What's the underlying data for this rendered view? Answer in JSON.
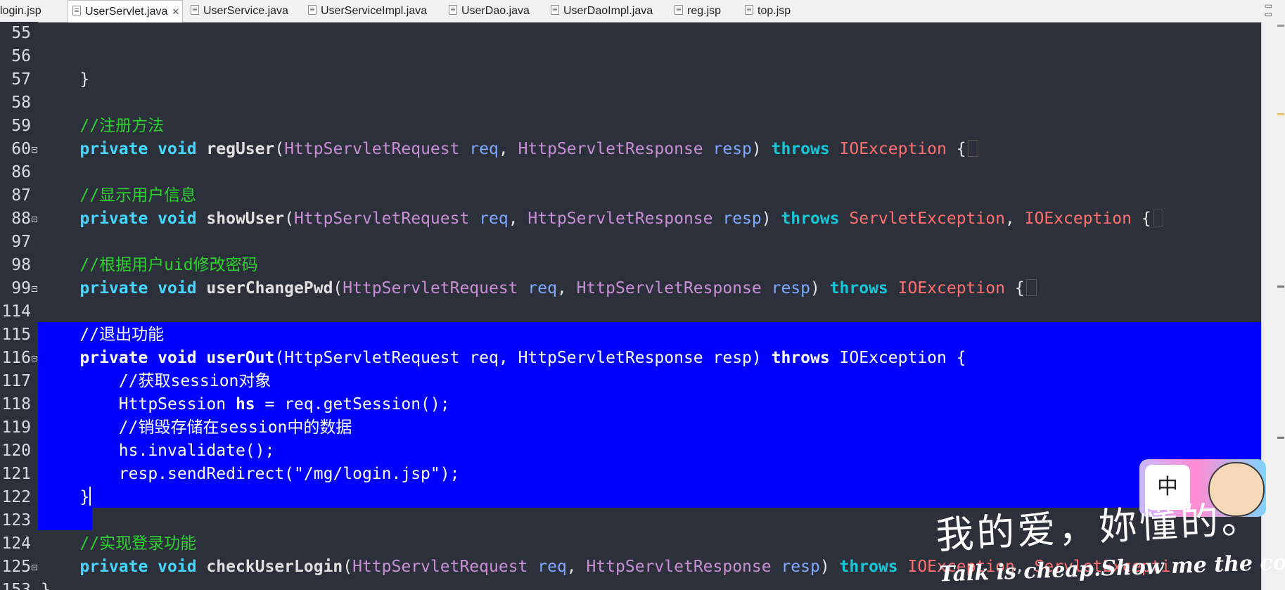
{
  "tabs": [
    {
      "label": "login.jsp",
      "active": false
    },
    {
      "label": "UserServlet.java",
      "active": true
    },
    {
      "label": "UserService.java",
      "active": false
    },
    {
      "label": "UserServiceImpl.java",
      "active": false
    },
    {
      "label": "UserDao.java",
      "active": false
    },
    {
      "label": "UserDaoImpl.java",
      "active": false
    },
    {
      "label": "reg.jsp",
      "active": false
    },
    {
      "label": "top.jsp",
      "active": false
    }
  ],
  "window_controls": {
    "minimize": "▭",
    "maximize": "▭"
  },
  "lines": [
    {
      "n": "55",
      "fold": false,
      "tokens": []
    },
    {
      "n": "56",
      "fold": false,
      "tokens": []
    },
    {
      "n": "57",
      "fold": false,
      "tokens": [
        {
          "t": "    }",
          "c": "plain"
        }
      ]
    },
    {
      "n": "58",
      "fold": false,
      "tokens": []
    },
    {
      "n": "59",
      "fold": false,
      "tokens": [
        {
          "t": "    //注册方法",
          "c": "comment"
        }
      ]
    },
    {
      "n": "60",
      "fold": true,
      "tokens": [
        {
          "t": "    private void ",
          "c": "kw"
        },
        {
          "t": "regUser",
          "c": "method"
        },
        {
          "t": "(",
          "c": "plain"
        },
        {
          "t": "HttpServletRequest ",
          "c": "type"
        },
        {
          "t": "req",
          "c": "param"
        },
        {
          "t": ", ",
          "c": "plain"
        },
        {
          "t": "HttpServletResponse ",
          "c": "type"
        },
        {
          "t": "resp",
          "c": "param"
        },
        {
          "t": ") ",
          "c": "plain"
        },
        {
          "t": "throws ",
          "c": "kw2"
        },
        {
          "t": "IOException",
          "c": "exc"
        },
        {
          "t": " {",
          "c": "plain"
        },
        {
          "t": "",
          "c": "fold"
        }
      ]
    },
    {
      "n": "86",
      "fold": false,
      "tokens": []
    },
    {
      "n": "87",
      "fold": false,
      "tokens": [
        {
          "t": "    //显示用户信息",
          "c": "comment"
        }
      ]
    },
    {
      "n": "88",
      "fold": true,
      "tokens": [
        {
          "t": "    private void ",
          "c": "kw"
        },
        {
          "t": "showUser",
          "c": "method"
        },
        {
          "t": "(",
          "c": "plain"
        },
        {
          "t": "HttpServletRequest ",
          "c": "type"
        },
        {
          "t": "req",
          "c": "param"
        },
        {
          "t": ", ",
          "c": "plain"
        },
        {
          "t": "HttpServletResponse ",
          "c": "type"
        },
        {
          "t": "resp",
          "c": "param"
        },
        {
          "t": ") ",
          "c": "plain"
        },
        {
          "t": "throws ",
          "c": "kw2"
        },
        {
          "t": "ServletException",
          "c": "exc"
        },
        {
          "t": ", ",
          "c": "plain"
        },
        {
          "t": "IOException",
          "c": "exc"
        },
        {
          "t": " {",
          "c": "plain"
        },
        {
          "t": "",
          "c": "fold"
        }
      ]
    },
    {
      "n": "97",
      "fold": false,
      "tokens": []
    },
    {
      "n": "98",
      "fold": false,
      "tokens": [
        {
          "t": "    //根据用户uid修改密码",
          "c": "comment"
        }
      ]
    },
    {
      "n": "99",
      "fold": true,
      "tokens": [
        {
          "t": "    private void ",
          "c": "kw"
        },
        {
          "t": "userChangePwd",
          "c": "method"
        },
        {
          "t": "(",
          "c": "plain"
        },
        {
          "t": "HttpServletRequest ",
          "c": "type"
        },
        {
          "t": "req",
          "c": "param"
        },
        {
          "t": ", ",
          "c": "plain"
        },
        {
          "t": "HttpServletResponse ",
          "c": "type"
        },
        {
          "t": "resp",
          "c": "param"
        },
        {
          "t": ") ",
          "c": "plain"
        },
        {
          "t": "throws ",
          "c": "kw2"
        },
        {
          "t": "IOException",
          "c": "exc"
        },
        {
          "t": " {",
          "c": "plain"
        },
        {
          "t": "",
          "c": "fold"
        }
      ]
    },
    {
      "n": "114",
      "fold": false,
      "tokens": []
    },
    {
      "n": "115",
      "fold": false,
      "sel": true,
      "tokens": [
        {
          "t": "    //退出功能",
          "c": "comment"
        }
      ]
    },
    {
      "n": "116",
      "fold": true,
      "sel": true,
      "tokens": [
        {
          "t": "    private void ",
          "c": "kw"
        },
        {
          "t": "userOut",
          "c": "method"
        },
        {
          "t": "(",
          "c": "plain"
        },
        {
          "t": "HttpServletRequest ",
          "c": "type"
        },
        {
          "t": "req",
          "c": "param"
        },
        {
          "t": ", ",
          "c": "plain"
        },
        {
          "t": "HttpServletResponse ",
          "c": "type"
        },
        {
          "t": "resp",
          "c": "param"
        },
        {
          "t": ") ",
          "c": "plain"
        },
        {
          "t": "throws ",
          "c": "kw2"
        },
        {
          "t": "IOException",
          "c": "exc"
        },
        {
          "t": " {",
          "c": "plain"
        }
      ]
    },
    {
      "n": "117",
      "fold": false,
      "sel": true,
      "tokens": [
        {
          "t": "        //获取session对象",
          "c": "comment"
        }
      ]
    },
    {
      "n": "118",
      "fold": false,
      "sel": true,
      "tokens": [
        {
          "t": "        HttpSession ",
          "c": "plain"
        },
        {
          "t": "hs",
          "c": "method"
        },
        {
          "t": " = req.getSession();",
          "c": "plain"
        }
      ]
    },
    {
      "n": "119",
      "fold": false,
      "sel": true,
      "tokens": [
        {
          "t": "        //销毁存储在session中的数据",
          "c": "comment"
        }
      ]
    },
    {
      "n": "120",
      "fold": false,
      "sel": true,
      "tokens": [
        {
          "t": "        hs.invalidate();",
          "c": "plain"
        }
      ]
    },
    {
      "n": "121",
      "fold": false,
      "sel": true,
      "tokens": [
        {
          "t": "        resp.sendRedirect(\"/mg/login.jsp\");",
          "c": "plain"
        }
      ]
    },
    {
      "n": "122",
      "fold": false,
      "sel": true,
      "caret": true,
      "tokens": [
        {
          "t": "    }",
          "c": "plain"
        }
      ]
    },
    {
      "n": "123",
      "fold": false,
      "tokens": []
    },
    {
      "n": "124",
      "fold": false,
      "tokens": [
        {
          "t": "    //实现登录功能",
          "c": "comment"
        }
      ]
    },
    {
      "n": "125",
      "fold": true,
      "tokens": [
        {
          "t": "    private void ",
          "c": "kw"
        },
        {
          "t": "checkUserLogin",
          "c": "method"
        },
        {
          "t": "(",
          "c": "plain"
        },
        {
          "t": "HttpServletRequest ",
          "c": "type"
        },
        {
          "t": "req",
          "c": "param"
        },
        {
          "t": ", ",
          "c": "plain"
        },
        {
          "t": "HttpServletResponse ",
          "c": "type"
        },
        {
          "t": "resp",
          "c": "param"
        },
        {
          "t": ") ",
          "c": "plain"
        },
        {
          "t": "throws ",
          "c": "kw2"
        },
        {
          "t": "IOException",
          "c": "exc"
        },
        {
          "t": ", ",
          "c": "plain"
        },
        {
          "t": "ServletExcepti",
          "c": "exc"
        }
      ]
    },
    {
      "n": "153",
      "fold": false,
      "tokens": [
        {
          "t": "}",
          "c": "plain"
        }
      ]
    }
  ],
  "ime": {
    "label": "中"
  },
  "wallpaper": {
    "caption": "我的爱，妳懂的。",
    "slogan": "Talk is cheap.Show me the code!"
  },
  "colors": {
    "background": "#2b303b",
    "selection": "#0000ff",
    "comment": "#2ed02e",
    "keyword": "#46d7ff",
    "type": "#c98fd6",
    "param": "#7ea9ff",
    "exception": "#ff6f6f"
  }
}
